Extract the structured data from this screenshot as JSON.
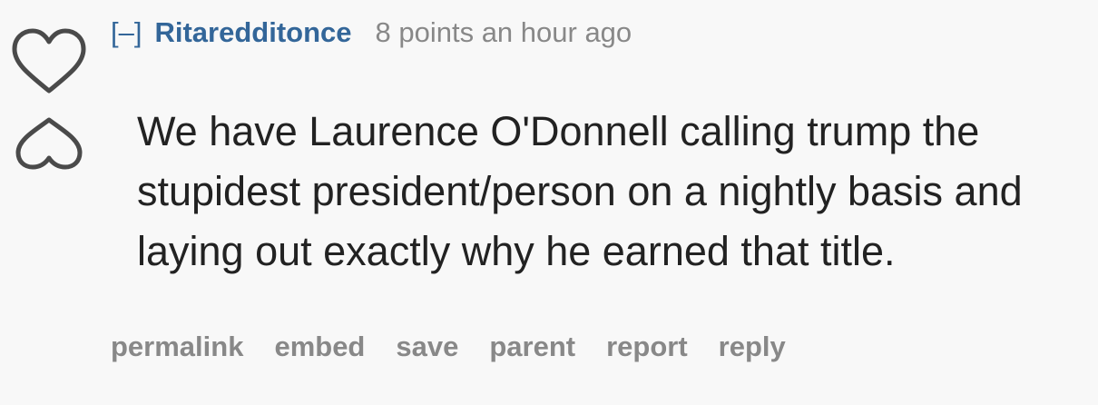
{
  "vote": {
    "upvote_icon": "heart-outline-icon",
    "downvote_icon": "heart-outline-inverted-icon",
    "color": "#4a4a4a"
  },
  "comment": {
    "toggle_label": "[–]",
    "author": "Ritaredditonce",
    "meta": "8 points an hour ago",
    "body": "We have Laurence O'Donnell calling trump the stupidest president/person on a nightly basis and laying out exactly why he earned that title."
  },
  "actions": {
    "permalink": "permalink",
    "embed": "embed",
    "save": "save",
    "parent": "parent",
    "report": "report",
    "reply": "reply"
  },
  "colors": {
    "background": "#f8f8f8",
    "author": "#336699",
    "meta": "#888888",
    "text": "#222222"
  }
}
